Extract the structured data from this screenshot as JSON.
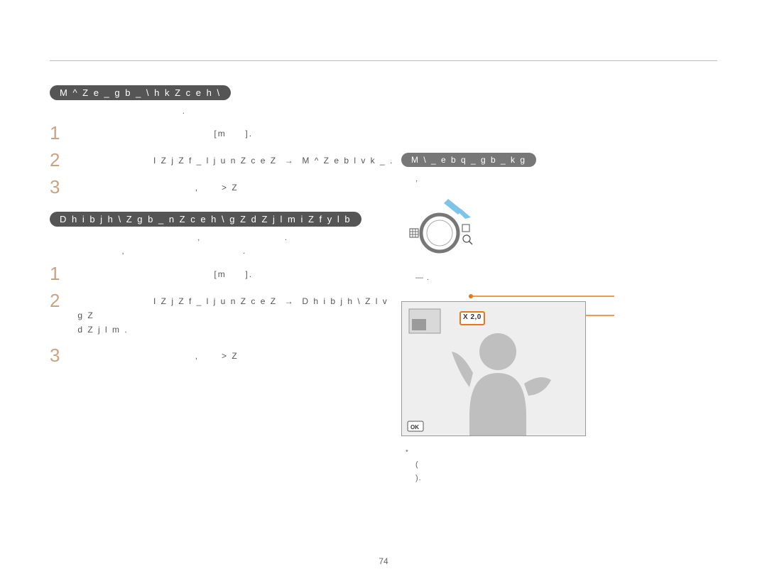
{
  "section1": {
    "heading": "M ^ Z e _ g b _  \\  h k Z c e h \\",
    "desc": "                                   .",
    "steps": [
      "                                     [m     ].",
      "                     I Z j Z f _ l j u n Z c e Z  →  M ^ Z e b l v k _ .",
      "                                ,      > Z"
    ]
  },
  "section2": {
    "heading": "D h i b j h \\ Z g b _ n Z c e h \\  g Z  d Z j l m i Z f y l b",
    "desc": "                                       ,                      .\n                   ,                               .",
    "steps": [
      "                                     [m     ].",
      "                     I Z j Z f _ l j u n Z c e Z  →  D h i b j h \\ Z l v\n g Z\n d Z j l m .",
      "                                ,      > Z"
    ]
  },
  "right": {
    "heading": "M \\ _ e b q _ g b _  k g",
    "notes": [
      "",
      "                                                  ,",
      "                        —       .",
      "",
      "                                           (",
      "                                     )."
    ],
    "zoom_badge": "X 2,0",
    "ok_label": "OK"
  },
  "page_number": "74",
  "arrow": "→"
}
